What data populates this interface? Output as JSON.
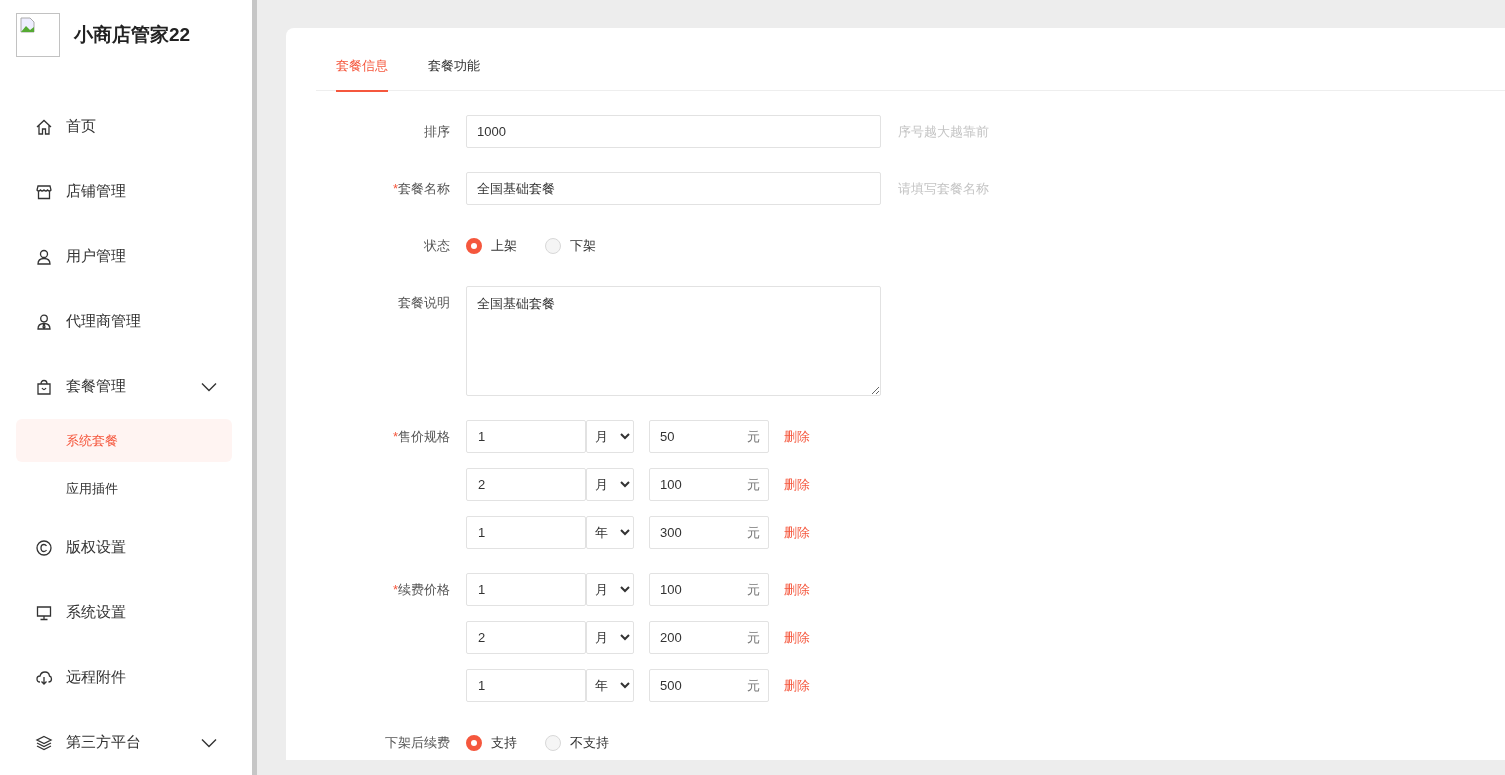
{
  "app": {
    "title": "小商店管家22"
  },
  "sidebar": {
    "items": [
      {
        "label": "首页",
        "selected": false
      },
      {
        "label": "店铺管理",
        "selected": false
      },
      {
        "label": "用户管理",
        "selected": false
      },
      {
        "label": "代理商管理",
        "selected": false
      },
      {
        "label": "套餐管理",
        "selected": false,
        "submenu": true,
        "children": [
          {
            "label": "系统套餐",
            "selected": true
          },
          {
            "label": "应用插件",
            "selected": false
          }
        ]
      },
      {
        "label": "版权设置",
        "selected": false
      },
      {
        "label": "系统设置",
        "selected": false
      },
      {
        "label": "远程附件",
        "selected": false
      },
      {
        "label": "第三方平台",
        "selected": false,
        "submenu": true
      }
    ]
  },
  "tabs": [
    {
      "label": "套餐信息",
      "selected": true
    },
    {
      "label": "套餐功能",
      "selected": false
    }
  ],
  "form": {
    "rows": [
      {
        "kind": "text",
        "label": "排序",
        "value": "1000",
        "hint": "序号越大越靠前"
      },
      {
        "kind": "text",
        "label": "套餐名称",
        "required_mark": "*",
        "value": "全国基础套餐",
        "hint": "请填写套餐名称"
      },
      {
        "kind": "radio",
        "label": "状态",
        "options": [
          {
            "label": "上架",
            "selected": true
          },
          {
            "label": "下架",
            "selected": false
          }
        ]
      },
      {
        "kind": "textarea",
        "label": "套餐说明",
        "value": "全国基础套餐"
      },
      {
        "kind": "prices",
        "label": "售价规格",
        "required_mark": "*",
        "items": [
          {
            "qty": "1",
            "unit": "月",
            "price": "50",
            "currency": "元",
            "action": "删除"
          },
          {
            "qty": "2",
            "unit": "月",
            "price": "100",
            "currency": "元",
            "action": "删除"
          },
          {
            "qty": "1",
            "unit": "年",
            "price": "300",
            "currency": "元",
            "action": "删除"
          }
        ]
      },
      {
        "kind": "prices",
        "label": "续费价格",
        "required_mark": "*",
        "items": [
          {
            "qty": "1",
            "unit": "月",
            "price": "100",
            "currency": "元",
            "action": "删除"
          },
          {
            "qty": "2",
            "unit": "月",
            "price": "200",
            "currency": "元",
            "action": "删除"
          },
          {
            "qty": "1",
            "unit": "年",
            "price": "500",
            "currency": "元",
            "action": "删除"
          }
        ]
      },
      {
        "kind": "radio",
        "label": "下架后续费",
        "options": [
          {
            "label": "支持",
            "selected": true
          },
          {
            "label": "不支持",
            "selected": false
          }
        ]
      }
    ]
  }
}
